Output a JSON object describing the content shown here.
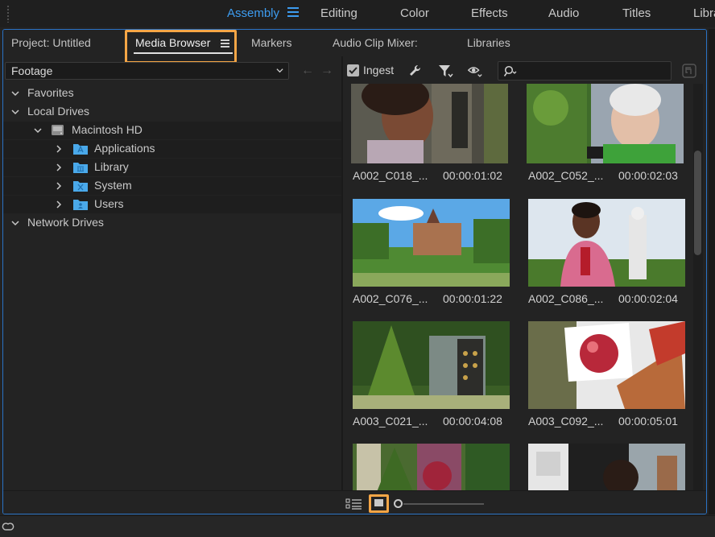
{
  "workspaces": {
    "tabs": [
      "Assembly",
      "Editing",
      "Color",
      "Effects",
      "Audio",
      "Titles",
      "Libra"
    ],
    "active": "Assembly"
  },
  "panel": {
    "tabs": [
      "Project: Untitled",
      "Media Browser",
      "Markers",
      "Audio Clip Mixer:",
      "Libraries"
    ],
    "active": "Media Browser"
  },
  "toolbar": {
    "dropdown_value": "Footage",
    "ingest_label": "Ingest",
    "ingest_checked": true,
    "search_placeholder": ""
  },
  "tree": {
    "items": [
      {
        "label": "Favorites",
        "level": 0,
        "expanded": true,
        "icon": null
      },
      {
        "label": "Local Drives",
        "level": 0,
        "expanded": true,
        "icon": null
      },
      {
        "label": "Macintosh HD",
        "level": 1,
        "expanded": true,
        "icon": "hard-drive-icon"
      },
      {
        "label": "Applications",
        "level": 2,
        "expanded": false,
        "icon": "applications-folder-icon"
      },
      {
        "label": "Library",
        "level": 2,
        "expanded": false,
        "icon": "library-folder-icon"
      },
      {
        "label": "System",
        "level": 2,
        "expanded": false,
        "icon": "system-folder-icon"
      },
      {
        "label": "Users",
        "level": 2,
        "expanded": false,
        "icon": "users-folder-icon"
      },
      {
        "label": "Network Drives",
        "level": 0,
        "expanded": true,
        "icon": null
      }
    ]
  },
  "clips": [
    {
      "name": "A002_C018_...",
      "duration": "00:00:01:02"
    },
    {
      "name": "A002_C052_...",
      "duration": "00:00:02:03"
    },
    {
      "name": "A002_C076_...",
      "duration": "00:00:01:22"
    },
    {
      "name": "A002_C086_...",
      "duration": "00:00:02:04"
    },
    {
      "name": "A003_C021_...",
      "duration": "00:00:04:08"
    },
    {
      "name": "A003_C092_...",
      "duration": "00:00:05:01"
    },
    {
      "name": "",
      "duration": ""
    },
    {
      "name": "",
      "duration": ""
    }
  ],
  "colors": {
    "accent": "#3d9cf0",
    "highlight": "#f5a646",
    "background": "#232323"
  }
}
